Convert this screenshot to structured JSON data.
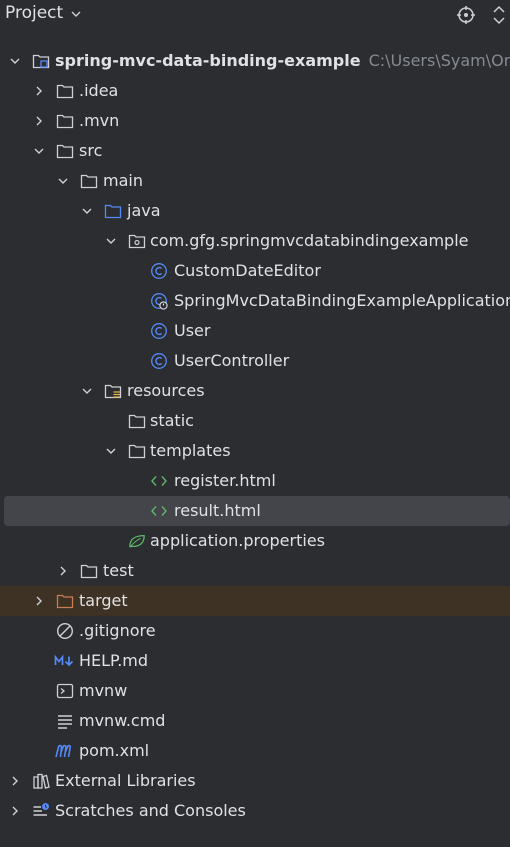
{
  "header": {
    "title": "Project"
  },
  "tree": {
    "root_label": "spring-mvc-data-binding-example",
    "root_path": "C:\\Users\\Syam\\One",
    "idea": ".idea",
    "mvn": ".mvn",
    "src": "src",
    "main": "main",
    "java": "java",
    "package": "com.gfg.springmvcdatabindingexample",
    "custom_date_editor": "CustomDateEditor",
    "app_class": "SpringMvcDataBindingExampleApplication",
    "user": "User",
    "user_controller": "UserController",
    "resources": "resources",
    "static": "static",
    "templates": "templates",
    "register_html": "register.html",
    "result_html": "result.html",
    "app_properties": "application.properties",
    "test": "test",
    "target": "target",
    "gitignore": ".gitignore",
    "help_md": "HELP.md",
    "mvnw": "mvnw",
    "mvnw_cmd": "mvnw.cmd",
    "pom_xml": "pom.xml",
    "external_libraries": "External Libraries",
    "scratches": "Scratches and Consoles"
  },
  "colors": {
    "background": "#2b2d30",
    "selected_row": "#43454a",
    "excluded_row": "#3d3223",
    "class_icon": "#548af7",
    "html_icon": "#5fb865",
    "target_folder": "#c77d55"
  }
}
